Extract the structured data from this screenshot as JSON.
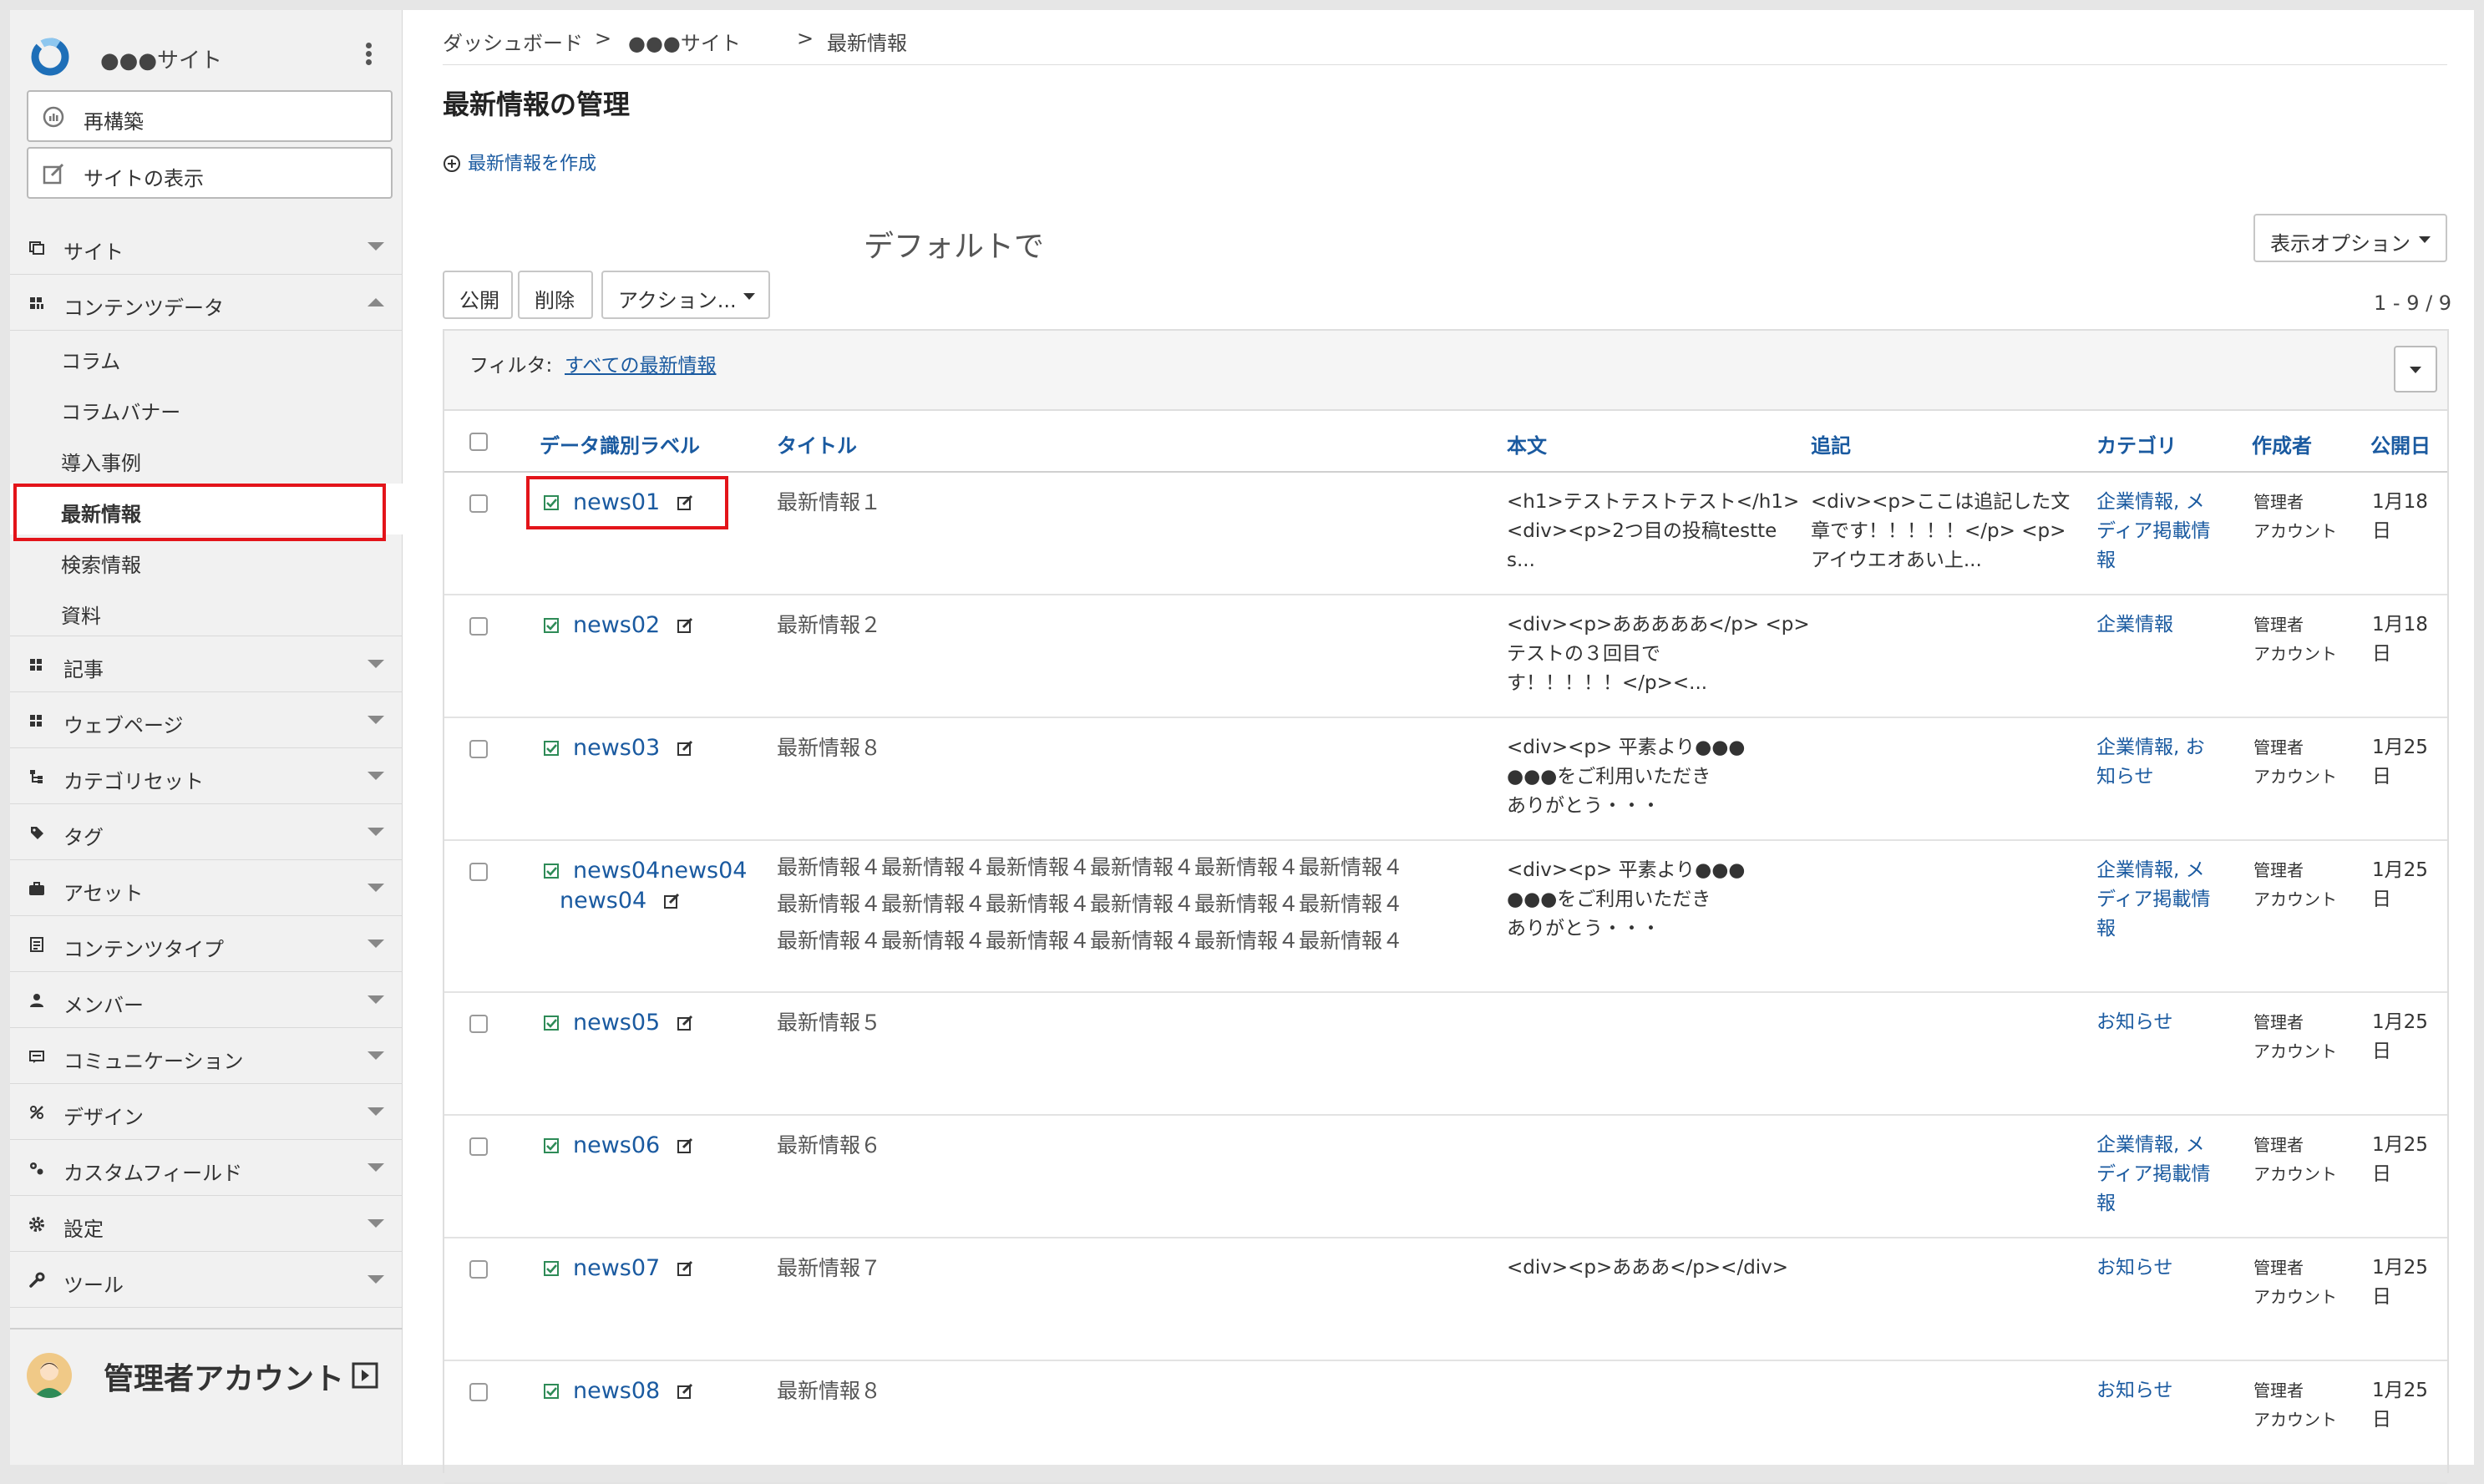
{
  "sidebar": {
    "site_name": "●●●サイト",
    "rebuild_label": "再構築",
    "view_site_label": "サイトの表示",
    "menu": [
      {
        "label": "サイト",
        "icon": "site-icon"
      },
      {
        "label": "コンテンツデータ",
        "icon": "content-data-icon"
      },
      {
        "label": "記事",
        "icon": "article-icon"
      },
      {
        "label": "ウェブページ",
        "icon": "webpage-icon"
      },
      {
        "label": "カテゴリセット",
        "icon": "category-set-icon"
      },
      {
        "label": "タグ",
        "icon": "tag-icon"
      },
      {
        "label": "アセット",
        "icon": "asset-icon"
      },
      {
        "label": "コンテンツタイプ",
        "icon": "content-type-icon"
      },
      {
        "label": "メンバー",
        "icon": "member-icon"
      },
      {
        "label": "コミュニケーション",
        "icon": "communication-icon"
      },
      {
        "label": "デザイン",
        "icon": "design-icon"
      },
      {
        "label": "カスタムフィールド",
        "icon": "custom-field-icon"
      },
      {
        "label": "設定",
        "icon": "settings-icon"
      },
      {
        "label": "ツール",
        "icon": "tools-icon"
      }
    ],
    "submenu": [
      "コラム",
      "コラムバナー",
      "導入事例",
      "最新情報",
      "検索情報",
      "資料"
    ],
    "user_name": "管理者アカウント"
  },
  "breadcrumb": {
    "dashboard": "ダッシュボード",
    "sep": ">",
    "site": "●●●サイト",
    "current": "最新情報"
  },
  "page": {
    "title": "最新情報の管理",
    "create_label": "最新情報を作成",
    "default_text": "デフォルトで",
    "display_options_label": "表示オプション",
    "publish_label": "公開",
    "delete_label": "削除",
    "actions_label": "アクション...",
    "count": "1 - 9 / 9"
  },
  "filter": {
    "label": "フィルタ:",
    "value": "すべての最新情報"
  },
  "table": {
    "columns": [
      "データ識別ラベル",
      "タイトル",
      "本文",
      "追記",
      "カテゴリ",
      "作成者",
      "公開日"
    ],
    "rows": [
      {
        "label": "news01",
        "title": "最新情報１",
        "body": [
          "<h1>テストテストテスト</h1>",
          "<div><p>2つ目の投稿testte",
          "s..."
        ],
        "extra": [
          "<div><p>ここは追記した文",
          "章です！！！！！</p> <p>",
          "アイウエオあい上..."
        ],
        "category": [
          "企業情報, メ",
          "ディア掲載情",
          "報"
        ],
        "author": [
          "管理者",
          "アカウント"
        ],
        "date": [
          "1月18",
          "日"
        ]
      },
      {
        "label": "news02",
        "title": "最新情報２",
        "body": [
          "<div><p>あああああ</p> <p>",
          "テストの３回目で",
          "す！！！！！</p><..."
        ],
        "extra": [],
        "category": [
          "企業情報"
        ],
        "author": [
          "管理者",
          "アカウント"
        ],
        "date": [
          "1月18",
          "日"
        ]
      },
      {
        "label": "news03",
        "title": "最新情報８",
        "body": [
          "<div><p> 平素より●●●",
          "●●●をご利用いただき",
          "ありがとう・・・"
        ],
        "extra": [],
        "category": [
          "企業情報, お",
          "知らせ"
        ],
        "author": [
          "管理者",
          "アカウント"
        ],
        "date": [
          "1月25",
          "日"
        ]
      },
      {
        "label": "news04news04",
        "label2": "news04",
        "title_lines": [
          "最新情報４最新情報４最新情報４最新情報４最新情報４最新情報４",
          "最新情報４最新情報４最新情報４最新情報４最新情報４最新情報４",
          "最新情報４最新情報４最新情報４最新情報４最新情報４最新情報４"
        ],
        "body": [
          "<div><p> 平素より●●●",
          "●●●をご利用いただき",
          "ありがとう・・・"
        ],
        "extra": [],
        "category": [
          "企業情報, メ",
          "ディア掲載情",
          "報"
        ],
        "author": [
          "管理者",
          "アカウント"
        ],
        "date": [
          "1月25",
          "日"
        ]
      },
      {
        "label": "news05",
        "title": "最新情報５",
        "body": [],
        "extra": [],
        "category": [
          "お知らせ"
        ],
        "author": [
          "管理者",
          "アカウント"
        ],
        "date": [
          "1月25",
          "日"
        ]
      },
      {
        "label": "news06",
        "title": "最新情報６",
        "body": [],
        "extra": [],
        "category": [
          "企業情報, メ",
          "ディア掲載情",
          "報"
        ],
        "author": [
          "管理者",
          "アカウント"
        ],
        "date": [
          "1月25",
          "日"
        ]
      },
      {
        "label": "news07",
        "title": "最新情報７",
        "body": [
          "<div><p>あああ</p></div>"
        ],
        "extra": [],
        "category": [
          "お知らせ"
        ],
        "author": [
          "管理者",
          "アカウント"
        ],
        "date": [
          "1月25",
          "日"
        ]
      },
      {
        "label": "news08",
        "title": "最新情報８",
        "body": [],
        "extra": [],
        "category": [
          "お知らせ"
        ],
        "author": [
          "管理者",
          "アカウント"
        ],
        "date": [
          "1月25",
          "日"
        ]
      }
    ]
  },
  "colors": {
    "link": "#1a5aa0",
    "highlight": "#e3141a",
    "check": "#2e8b57",
    "sidebar_bg": "#f1f1f1"
  }
}
